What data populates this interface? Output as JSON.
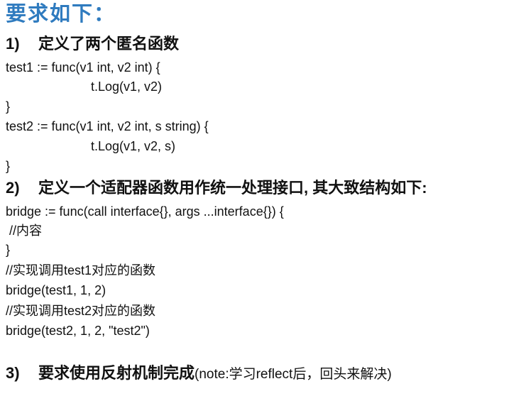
{
  "title": "要求如下：",
  "section1": {
    "number": "1)",
    "heading": "定义了两个匿名函数"
  },
  "code1": [
    "test1 := func(v1 int, v2 int) {",
    "t.Log(v1, v2)",
    "}",
    "test2 := func(v1 int, v2 int, s string) {",
    "t.Log(v1, v2, s)",
    "}"
  ],
  "section2": {
    "number": "2)",
    "heading": "定义一个适配器函数用作统一处理接口, 其大致结构如下:"
  },
  "code2": [
    "bridge := func(call interface{}, args ...interface{}) {",
    " //内容",
    "}",
    "//实现调用test1对应的函数",
    "bridge(test1, 1, 2)",
    "//实现调用test2对应的函数",
    "bridge(test2, 1, 2, \"test2\")"
  ],
  "section3": {
    "number": "3)",
    "heading": "要求使用反射机制完成",
    "note": "(note:学习reflect后，回头来解决)"
  },
  "colors": {
    "title": "#2f7bbf",
    "text": "#111111"
  }
}
